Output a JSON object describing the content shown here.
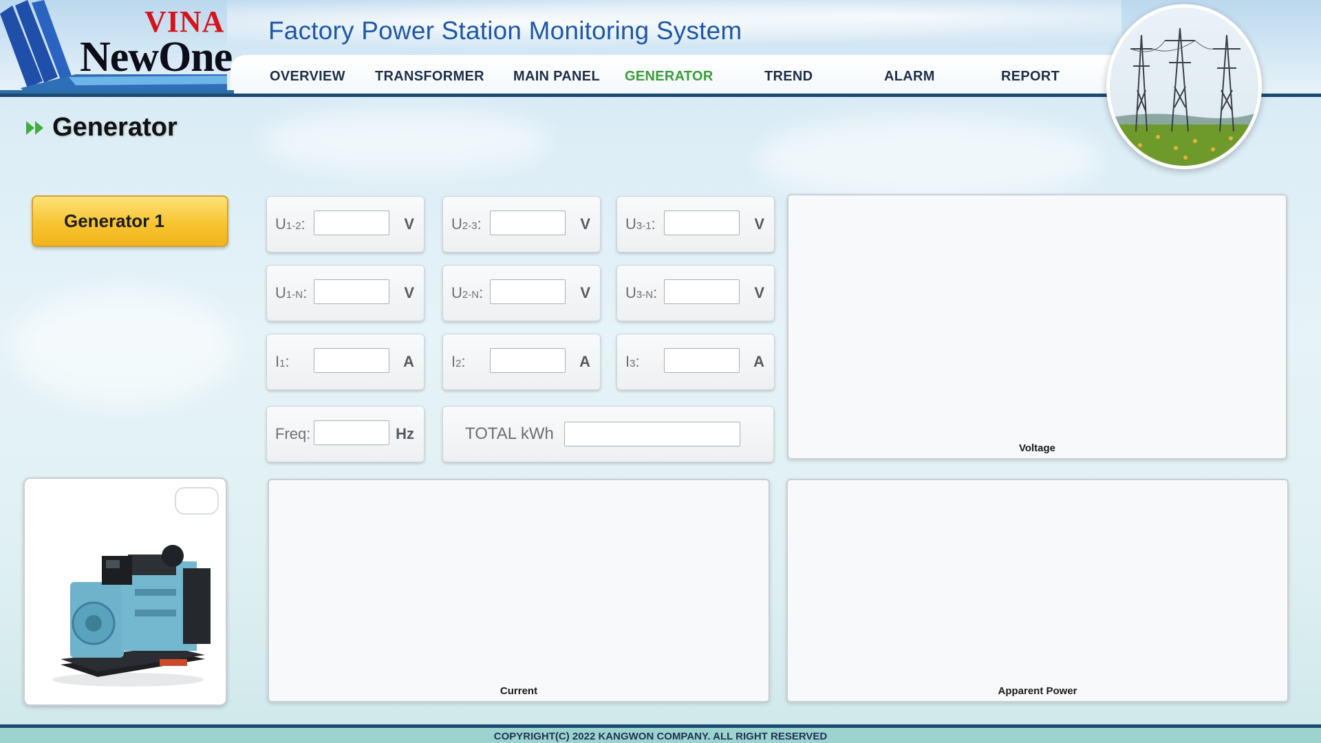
{
  "logo": {
    "line1": "VINA",
    "line2": "NewOne"
  },
  "app_title": "Factory Power Station Monitoring System",
  "nav": {
    "items": [
      "OVERVIEW",
      "TRANSFORMER",
      "MAIN PANEL",
      "GENERATOR",
      "TREND",
      "ALARM",
      "REPORT"
    ],
    "active": "GENERATOR"
  },
  "page_title": "Generator",
  "generator_button": "Generator 1",
  "measurements": {
    "u12": {
      "label": "U",
      "sub": "1-2",
      "suffix": ":",
      "value": "",
      "unit": "V"
    },
    "u23": {
      "label": "U",
      "sub": "2-3",
      "suffix": ":",
      "value": "",
      "unit": "V"
    },
    "u31": {
      "label": "U",
      "sub": "3-1",
      "suffix": ":",
      "value": "",
      "unit": "V"
    },
    "u1n": {
      "label": "U",
      "sub": "1-N",
      "suffix": ":",
      "value": "",
      "unit": "V"
    },
    "u2n": {
      "label": "U",
      "sub": "2-N",
      "suffix": ":",
      "value": "",
      "unit": "V"
    },
    "u3n": {
      "label": "U",
      "sub": "3-N",
      "suffix": ":",
      "value": "",
      "unit": "V"
    },
    "i1": {
      "label": "I",
      "sub": "1",
      "suffix": ":",
      "value": "",
      "unit": "A"
    },
    "i2": {
      "label": "I",
      "sub": "2",
      "suffix": ":",
      "value": "",
      "unit": "A"
    },
    "i3": {
      "label": "I",
      "sub": "3",
      "suffix": ":",
      "value": "",
      "unit": "A"
    },
    "freq": {
      "label": "Freq",
      "sub": "",
      "suffix": ":",
      "value": "",
      "unit": "Hz"
    }
  },
  "total_kwh": {
    "label": "TOTAL kWh",
    "value": ""
  },
  "charts": {
    "voltage": "Voltage",
    "current": "Current",
    "apparent_power": "Apparent Power"
  },
  "footer": "COPYRIGHT(C) 2022 KANGWON COMPANY. ALL RIGHT RESERVED",
  "colors": {
    "nav_active": "#3a9b3c",
    "title_blue": "#1f57a6",
    "button_yellow": "#f7c431",
    "brand_red": "#d4141c"
  }
}
